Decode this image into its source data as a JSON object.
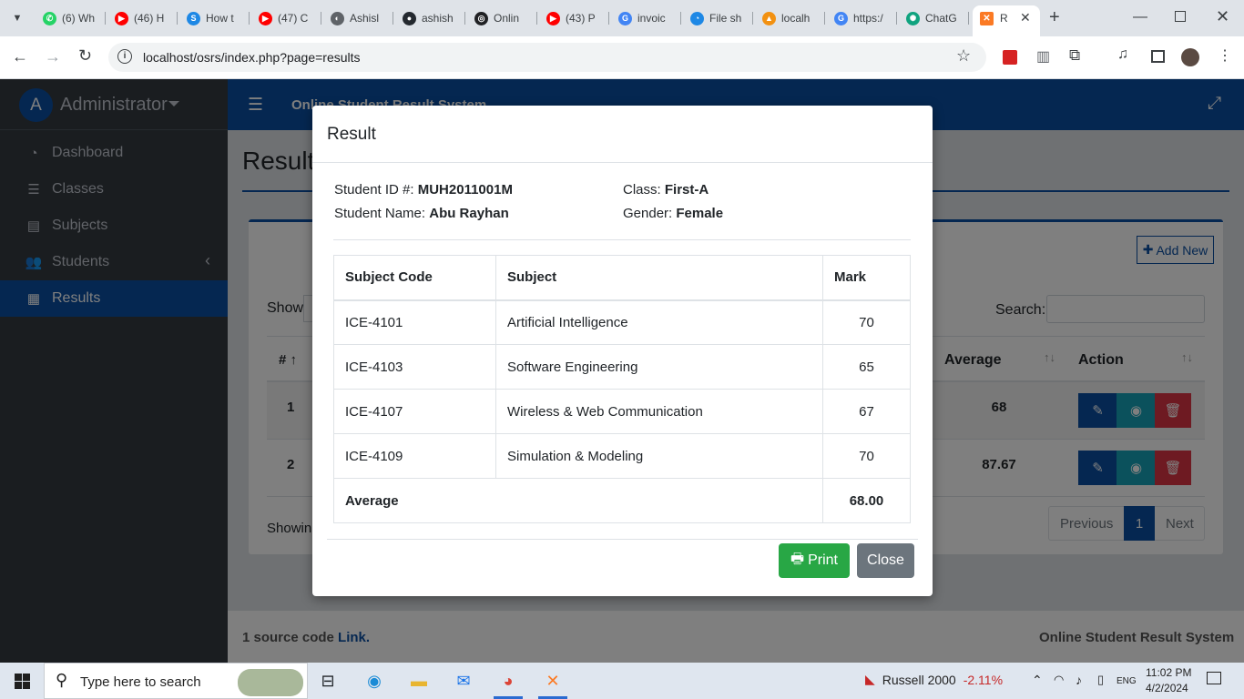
{
  "browser": {
    "tabs": [
      {
        "label": "(6) Wh",
        "color": "#25d366",
        "glyph": "✆",
        "icon": "whatsapp-icon"
      },
      {
        "label": "(46) H",
        "color": "#ff0000",
        "glyph": "▶",
        "icon": "youtube-icon"
      },
      {
        "label": "How t",
        "color": "#1e88e5",
        "glyph": "S",
        "icon": "site-icon"
      },
      {
        "label": "(47) C",
        "color": "#ff0000",
        "glyph": "▶",
        "icon": "youtube-icon"
      },
      {
        "label": "Ashisl",
        "color": "#5f6368",
        "glyph": "◐",
        "icon": "site-icon"
      },
      {
        "label": "ashish",
        "color": "#24292f",
        "glyph": "●",
        "icon": "github-icon"
      },
      {
        "label": "Onlin",
        "color": "#202124",
        "glyph": "◎",
        "icon": "site-icon"
      },
      {
        "label": "(43) P",
        "color": "#ff0000",
        "glyph": "▶",
        "icon": "youtube-icon"
      },
      {
        "label": "invoic",
        "color": "#4285f4",
        "glyph": "G",
        "icon": "google-icon"
      },
      {
        "label": "File sh",
        "color": "#1e88e5",
        "glyph": "◔",
        "icon": "site-icon"
      },
      {
        "label": "localh",
        "color": "#f29111",
        "glyph": "▲",
        "icon": "phpmyadmin-icon"
      },
      {
        "label": "https:/",
        "color": "#4285f4",
        "glyph": "G",
        "icon": "google-icon"
      },
      {
        "label": "ChatG",
        "color": "#10a37f",
        "glyph": "✺",
        "icon": "chatgpt-icon"
      }
    ],
    "active_tab_label": "R",
    "new_tab_glyph": "+",
    "url": "localhost/osrs/index.php?page=results"
  },
  "sidebar": {
    "user": "Administrator",
    "avatar_letter": "A",
    "items": [
      {
        "label": "Dashboard",
        "glyph": "◔",
        "icon": "dashboard-icon"
      },
      {
        "label": "Classes",
        "glyph": "☰",
        "icon": "classes-icon"
      },
      {
        "label": "Subjects",
        "glyph": "▤",
        "icon": "book-icon"
      },
      {
        "label": "Students",
        "glyph": "👥",
        "icon": "users-icon"
      },
      {
        "label": "Results",
        "glyph": "▦",
        "icon": "file-icon"
      }
    ]
  },
  "page": {
    "app_name": "Online Student Result System",
    "heading": "Results",
    "add_new": "Add New",
    "show_label": "Show",
    "search_label": "Search:",
    "col_hash": "#",
    "col_average": "Average",
    "col_action": "Action",
    "rows": [
      {
        "num": "1",
        "average": "68"
      },
      {
        "num": "2",
        "average": "87.67"
      }
    ],
    "showing": "Showin",
    "pagination": {
      "previous": "Previous",
      "page": "1",
      "next": "Next"
    },
    "footer_left_prefix": "1 source code ",
    "footer_link": "Link.",
    "footer_right": "Online Student Result System"
  },
  "modal": {
    "title": "Result",
    "student_id_label": "Student ID #:",
    "student_id": "MUH2011001M",
    "class_label": "Class:",
    "class": "First-A",
    "name_label": "Student Name:",
    "name": "Abu Rayhan",
    "gender_label": "Gender:",
    "gender": "Female",
    "headers": {
      "code": "Subject Code",
      "subject": "Subject",
      "mark": "Mark"
    },
    "rows": [
      {
        "code": "ICE-4101",
        "subject": "Artificial Intelligence",
        "mark": "70"
      },
      {
        "code": "ICE-4103",
        "subject": "Software Engineering",
        "mark": "65"
      },
      {
        "code": "ICE-4107",
        "subject": "Wireless & Web Communication",
        "mark": "67"
      },
      {
        "code": "ICE-4109",
        "subject": "Simulation & Modeling",
        "mark": "70"
      }
    ],
    "average_label": "Average",
    "average_value": "68.00",
    "print_label": "Print",
    "close_label": "Close"
  },
  "taskbar": {
    "search_placeholder": "Type here to search",
    "stock_name": "Russell 2000",
    "stock_change": "-2.11%",
    "time": "11:02 PM",
    "date": "4/2/2024",
    "lang": "ENG"
  },
  "colors": {
    "primary": "#0b4fa2",
    "sidebar": "#343a40",
    "success": "#28a745",
    "secondary": "#6c757d",
    "danger": "#dc3545",
    "info": "#17a2b8"
  }
}
